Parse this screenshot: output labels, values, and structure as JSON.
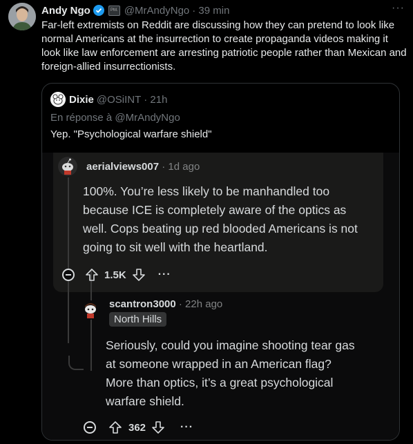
{
  "tweet": {
    "author_name": "Andy Ngo",
    "affiliation_badge": "PM.",
    "handle": "@MrAndyNgo",
    "time": "· 39 min",
    "more": "···",
    "text": "Far-left extremists on Reddit are discussing how they can pretend to look like normal Americans at the insurrection to create propaganda videos making it look like law enforcement are arresting patriotic people rather than Mexican and foreign-allied insurrectionists."
  },
  "quote": {
    "author_name": "Dixie",
    "handle": "@OSiINT",
    "time": "· 21h",
    "reply_to": "En réponse à @MrAndyNgo",
    "text": "Yep. \"Psychological warfare shield\""
  },
  "screenshot": {
    "comment1": {
      "username": "aerialviews007",
      "time": "· 1d ago",
      "lines": [
        "100%. You’re less likely to be manhandled too",
        "because ICE is completely aware of the optics as",
        "well. Cops beating up red blooded Americans is not",
        "going to sit well with the heartland."
      ],
      "votes": "1.5K",
      "more": "···"
    },
    "comment2": {
      "username": "scantron3000",
      "time": "· 22h ago",
      "flair": "North Hills",
      "lines": [
        "Seriously, could you imagine shooting tear gas",
        "at someone wrapped in an American flag?",
        "More than optics, it’s a great psychological",
        "warfare shield."
      ],
      "votes": "362",
      "more": "···"
    }
  },
  "colors": {
    "verified_blue": "#1d9bf0",
    "reddit_text": "#d7dadc",
    "reddit_muted": "#818384"
  },
  "icons": [
    "verified-badge-icon",
    "upvote-icon",
    "downvote-icon",
    "collapse-icon",
    "snoo-avatar-icon"
  ]
}
